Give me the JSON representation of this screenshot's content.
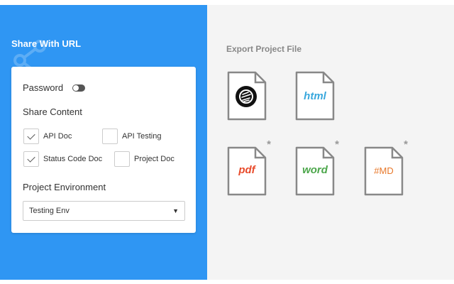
{
  "share": {
    "title": "Share With URL",
    "password_label": "Password",
    "password_enabled": false,
    "share_content_label": "Share Content",
    "options": [
      {
        "label": "API Doc",
        "checked": true
      },
      {
        "label": "API Testing",
        "checked": false
      },
      {
        "label": "Status Code Doc",
        "checked": true
      },
      {
        "label": "Project Doc",
        "checked": false
      }
    ],
    "env_label": "Project Environment",
    "env_selected": "Testing Env"
  },
  "export": {
    "title": "Export Project File",
    "files": [
      {
        "label": "",
        "icon": "app-logo-icon",
        "color": "#111111",
        "locked": false
      },
      {
        "label": "html",
        "color": "#3aa8dd",
        "locked": false
      },
      {
        "label": "pdf",
        "color": "#e84a2a",
        "locked": true
      },
      {
        "label": "word",
        "color": "#4ba64a",
        "locked": true
      },
      {
        "label": "#MD",
        "color": "#e8782a",
        "locked": true
      }
    ],
    "lock_symbol": "*"
  },
  "colors": {
    "accent": "#2f96f3",
    "right_bg": "#f4f4f4"
  }
}
